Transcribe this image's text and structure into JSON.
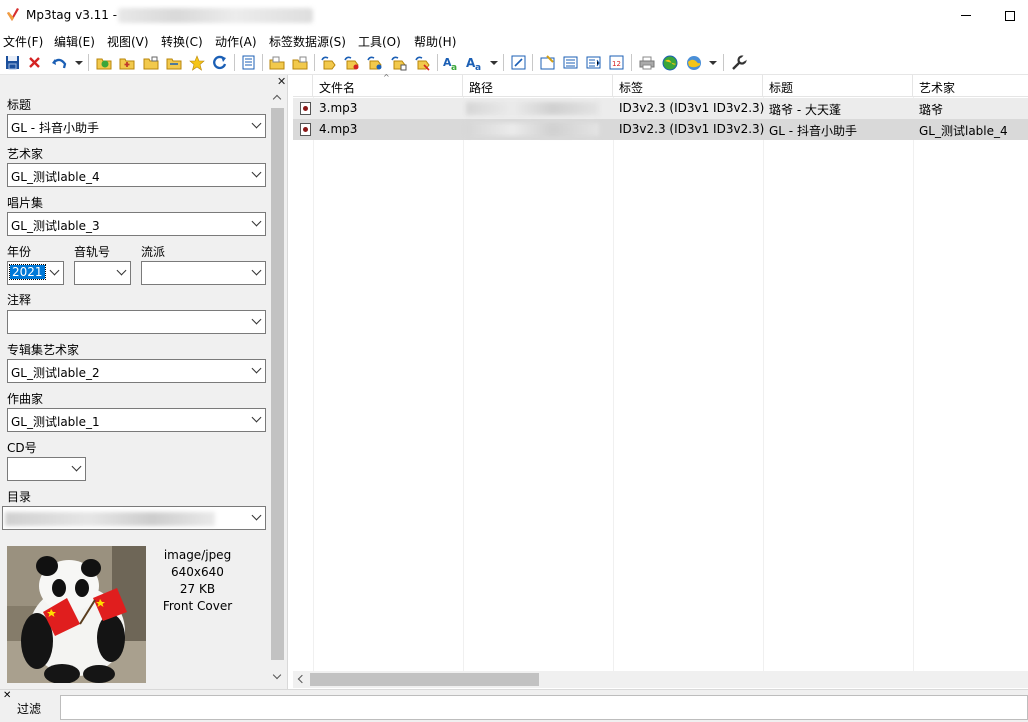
{
  "window": {
    "title": "Mp3tag v3.11  -",
    "colors": {
      "selection": "#0078d7",
      "panel_bg": "#f0f0f0",
      "selected_row": "#dcdcdc",
      "hover_row": "#e8e8e8"
    }
  },
  "menu": [
    "文件(F)",
    "编辑(E)",
    "视图(V)",
    "转换(C)",
    "动作(A)",
    "标签数据源(S)",
    "工具(O)",
    "帮助(H)"
  ],
  "toolbar_icons": [
    "save-icon",
    "delete-icon",
    "undo-icon",
    "add-dir-icon",
    "change-dir-icon",
    "folder-icon",
    "open-folder-icon",
    "favorite-icon",
    "refresh-icon",
    "copy-tag-icon",
    "paste-tag-icon",
    "columns-icon",
    "tag-to-file-icon",
    "file-to-tag-icon",
    "tag-to-tag-icon",
    "text-to-tag-icon",
    "tag-to-text-icon",
    "replace-icon",
    "case-icon",
    "export-icon",
    "autonumber-icon",
    "ini-icon",
    "numbering-icon",
    "scan-icon",
    "web-source-icon",
    "web-source2-icon",
    "tools-icon"
  ],
  "panel": {
    "title_label": "标题",
    "title_value": "GL - 抖音小助手",
    "artist_label": "艺术家",
    "artist_value": "GL_测试lable_4",
    "album_label": "唱片集",
    "album_value": "GL_测试lable_3",
    "year_label": "年份",
    "year_value": "2021",
    "track_label": "音轨号",
    "track_value": "",
    "genre_label": "流派",
    "genre_value": "",
    "comment_label": "注释",
    "comment_value": "",
    "album_artist_label": "专辑集艺术家",
    "album_artist_value": "GL_测试lable_2",
    "composer_label": "作曲家",
    "composer_value": "GL_测试lable_1",
    "disc_label": "CD号",
    "disc_value": "",
    "directory_label": "目录",
    "cover": {
      "mime": "image/jpeg",
      "dimensions": "640x640",
      "size": "27 KB",
      "type": "Front Cover"
    }
  },
  "list": {
    "columns": [
      "文件名",
      "路径",
      "标签",
      "标题",
      "艺术家"
    ],
    "rows": [
      {
        "filename": "3.mp3",
        "tag": "ID3v2.3 (ID3v1 ID3v2.3)",
        "title": "璐爷 - 大天蓬",
        "artist": "璐爷"
      },
      {
        "filename": "4.mp3",
        "tag": "ID3v2.3 (ID3v1 ID3v2.3)",
        "title": "GL - 抖音小助手",
        "artist": "GL_测试lable_4"
      }
    ]
  },
  "filter": {
    "label": "过滤",
    "value": ""
  }
}
